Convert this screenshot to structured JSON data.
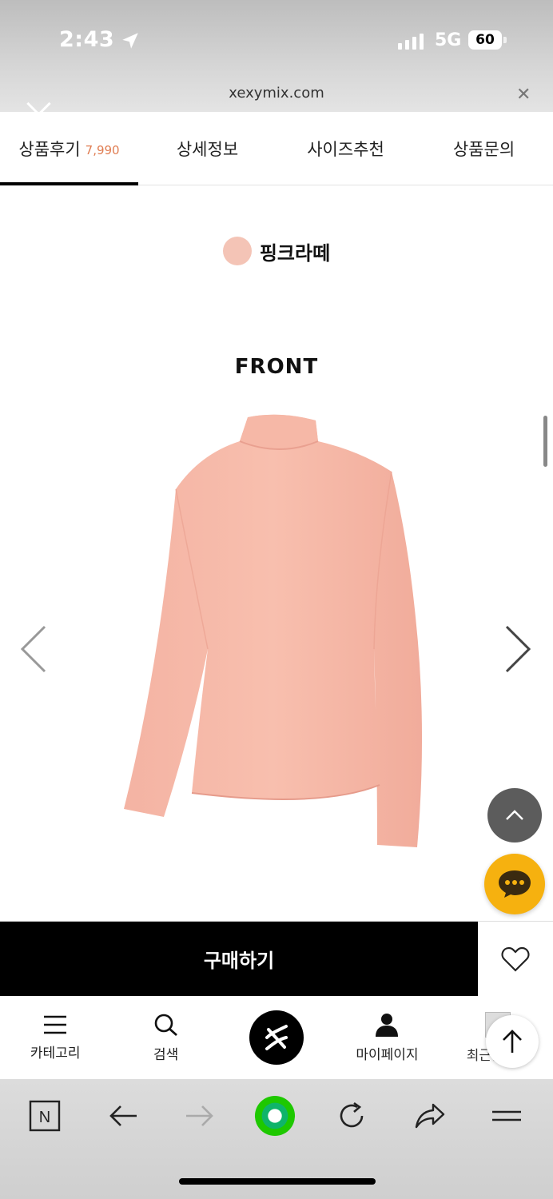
{
  "status_bar": {
    "time": "2:43",
    "network": "5G",
    "battery": "60"
  },
  "browser": {
    "url": "xexymix.com"
  },
  "tabs": [
    {
      "label": "상품후기",
      "count": "7,990",
      "active": true
    },
    {
      "label": "상세정보",
      "active": false
    },
    {
      "label": "사이즈추천",
      "active": false
    },
    {
      "label": "상품문의",
      "active": false
    }
  ],
  "product": {
    "color_name": "핑크라떼",
    "color_hex": "#f4c4b6",
    "view_label": "FRONT"
  },
  "buy_bar": {
    "buy_label": "구매하기"
  },
  "bottom_nav": {
    "items": [
      {
        "label": "카테고리",
        "icon": "menu-icon"
      },
      {
        "label": "검색",
        "icon": "search-icon"
      },
      {
        "label": "",
        "icon": "brand-logo-icon"
      },
      {
        "label": "마이페이지",
        "icon": "person-icon"
      },
      {
        "label": "최근본상품",
        "icon": "recent-icon"
      }
    ]
  },
  "colors": {
    "accent_count": "#e07d52",
    "chat": "#f6b10f",
    "buy": "#000000",
    "naver_green": "#1ec800"
  }
}
